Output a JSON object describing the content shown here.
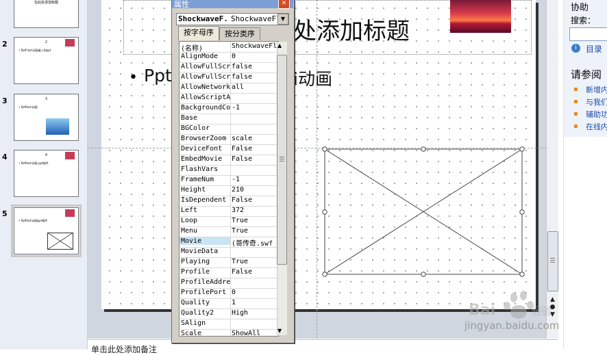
{
  "thumbnails": [
    {
      "num": "",
      "title": "在此处添加标题",
      "text": "",
      "selected": false
    },
    {
      "num": "2",
      "title": "2",
      "text": "• PptFlash动画嵌入到ppt",
      "selected": false
    },
    {
      "num": "3",
      "title": "3",
      "text": "• Pptflash动画",
      "selected": false
    },
    {
      "num": "4",
      "title": "4",
      "text": "• Pptflash动画 ppt插件",
      "selected": false
    },
    {
      "num": "5",
      "title": "",
      "text": "• Pptflash动画ppt插件",
      "selected": true
    }
  ],
  "slide": {
    "title": "处添加标题",
    "bullet_start": "Ppt",
    "bullet_end": "i动画"
  },
  "notes_placeholder": "单击此处添加备注",
  "properties_panel": {
    "title": "属性",
    "close": "✕",
    "object_name": "ShockwaveF.",
    "object_type": "ShockwaveFl",
    "tab_alphabetic": "按字母序",
    "tab_categorized": "按分类序",
    "rows": [
      {
        "name": "(名称)",
        "value": "ShockwaveFl"
      },
      {
        "name": "AlignMode",
        "value": "0"
      },
      {
        "name": "AllowFullScr",
        "value": "false"
      },
      {
        "name": "AllowFullScr",
        "value": "false"
      },
      {
        "name": "AllowNetwork",
        "value": "all"
      },
      {
        "name": "AllowScriptA",
        "value": ""
      },
      {
        "name": "BackgroundCo",
        "value": "-1"
      },
      {
        "name": "Base",
        "value": ""
      },
      {
        "name": "BGColor",
        "value": ""
      },
      {
        "name": "BrowserZoom",
        "value": "scale"
      },
      {
        "name": "DeviceFont",
        "value": "False"
      },
      {
        "name": "EmbedMovie",
        "value": "False"
      },
      {
        "name": "FlashVars",
        "value": ""
      },
      {
        "name": "FrameNum",
        "value": "-1"
      },
      {
        "name": "Height",
        "value": "210"
      },
      {
        "name": "IsDependent",
        "value": "False"
      },
      {
        "name": "Left",
        "value": "372"
      },
      {
        "name": "Loop",
        "value": "True"
      },
      {
        "name": "Menu",
        "value": "True"
      },
      {
        "name": "Movie",
        "value": "(哥传奇.swf"
      },
      {
        "name": "MovieData",
        "value": ""
      },
      {
        "name": "Playing",
        "value": "True"
      },
      {
        "name": "Profile",
        "value": "False"
      },
      {
        "name": "ProfileAddre",
        "value": ""
      },
      {
        "name": "ProfilePort",
        "value": "0"
      },
      {
        "name": "Quality",
        "value": "1"
      },
      {
        "name": "Quality2",
        "value": "High"
      },
      {
        "name": "SAlign",
        "value": ""
      },
      {
        "name": "Scale",
        "value": "ShowAll"
      }
    ],
    "selected_row": "Movie"
  },
  "task_pane": {
    "title": "协助",
    "search_label": "搜索：",
    "search_value": "",
    "toc_label": "目录",
    "see_also": "请参阅",
    "links": [
      "新增内",
      "与我们",
      "辅助功",
      "在线内"
    ]
  },
  "watermark": {
    "text": "jingyan.baidu.com",
    "logo": "Baidu 经验"
  },
  "colors": {
    "title_bar": "#7b9ed6",
    "close_button": "#d34a25",
    "link": "#1e4aa5",
    "bullet_orange": "#e8861c",
    "selected_row": "#c9e4f5"
  }
}
